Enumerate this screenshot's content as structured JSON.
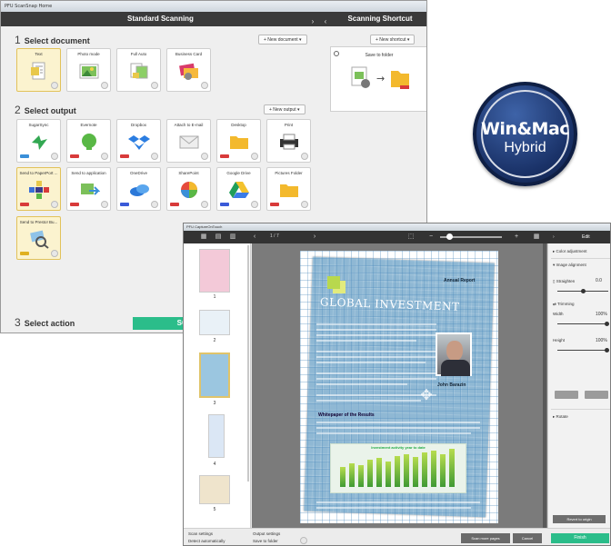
{
  "scanning_window": {
    "titlebar": "PFU ScanSnap Home",
    "header_title": "Standard Scanning",
    "shortcut_title": "Scanning Shortcut",
    "section1": {
      "number": "1",
      "title": "Select document",
      "new_button": "+ New document ▾"
    },
    "documents": [
      {
        "label": "Text",
        "icon": "text-document-icon",
        "selected": true
      },
      {
        "label": "Photo mode",
        "icon": "photo-mode-icon"
      },
      {
        "label": "Full Auto",
        "icon": "full-auto-icon"
      },
      {
        "label": "Business Card",
        "icon": "business-card-icon"
      }
    ],
    "shortcut": {
      "new_button": "+ New shortcut ▾",
      "label": "Save to folder"
    },
    "section2": {
      "number": "2",
      "title": "Select output",
      "new_button": "+ New output ▾"
    },
    "outputs_row1": [
      {
        "label": "SugarSync",
        "icon": "sugarsync-icon",
        "tag_color": "#3a8fd8"
      },
      {
        "label": "Evernote",
        "icon": "evernote-icon",
        "tag_color": "#d83a3a"
      },
      {
        "label": "Dropbox",
        "icon": "dropbox-icon",
        "tag_color": "#d83a3a"
      },
      {
        "label": "Attach to E-mail",
        "icon": "email-attach-icon",
        "tag_color": ""
      },
      {
        "label": "Desktop",
        "icon": "folder-icon",
        "tag_color": "#d83a3a"
      },
      {
        "label": "Print",
        "icon": "printer-icon",
        "tag_color": ""
      }
    ],
    "outputs_row2": [
      {
        "label": "Send to PaperPort ...",
        "icon": "paperport-icon",
        "tag_color": "#d83a3a",
        "selected": true
      },
      {
        "label": "Send to application",
        "icon": "application-icon",
        "tag_color": "#d83a3a"
      },
      {
        "label": "OneDrive",
        "icon": "onedrive-icon",
        "tag_color": "#3a5ad8"
      },
      {
        "label": "SharePoint",
        "icon": "sharepoint-icon",
        "tag_color": "#d83a3a"
      },
      {
        "label": "Google Drive",
        "icon": "google-drive-icon",
        "tag_color": "#3a5ad8"
      },
      {
        "label": "Pictures Folder",
        "icon": "folder-icon",
        "tag_color": "#d83a3a"
      }
    ],
    "outputs_row3": [
      {
        "label": "Send to Presto! Bu...",
        "icon": "presto-icon",
        "tag_color": "#e0b020",
        "selected": true
      }
    ],
    "section3": {
      "number": "3",
      "title": "Select action"
    },
    "scan_button": "SCAN"
  },
  "badge": {
    "title": "Win&Mac",
    "subtitle": "Hybrid"
  },
  "editor_window": {
    "titlebar": "PFU CaptureOnTouch",
    "page_count": "1 / 7",
    "edit_title": "Edit",
    "thumbnails": [
      "1",
      "2",
      "3",
      "4",
      "5"
    ],
    "document": {
      "headline": "GLOBAL INVESTMENT",
      "report_label": "Annual Report",
      "person_name": "John Barazin",
      "subhead": "Whitepaper of the Results",
      "chart_title": "Investment activity year to date"
    },
    "edit_panel": {
      "color_adjustment": "Color adjustment",
      "image_alignment": "Image alignment",
      "straighten_label": "Straighten",
      "straighten_value": "0.0",
      "trimming_label": "Trimming",
      "width_label": "Width",
      "width_value": "100%",
      "height_label": "Height",
      "height_value": "100%",
      "rotate_label": "Rotate",
      "revert_button": "Revert to origin"
    },
    "footer": {
      "scan_settings_label": "Scan settings",
      "scan_settings_value": "Detect automatically",
      "output_settings_label": "Output settings",
      "output_settings_value": "Save to folder",
      "scan_more_button": "Scan more pages",
      "cancel_button": "Cancel",
      "finish_button": "Finish"
    }
  },
  "colors": {
    "scan_green": "#2bbd8a",
    "badge_navy": "#1a3268",
    "selection_gold": "#e2c25a"
  }
}
